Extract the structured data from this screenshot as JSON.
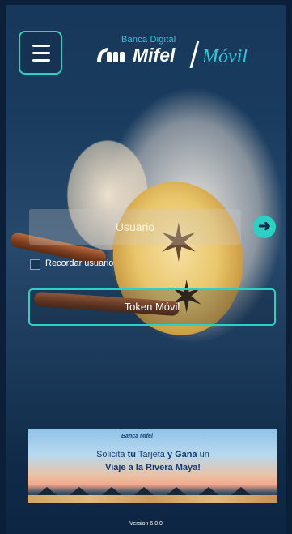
{
  "header": {
    "menu_icon": "hamburger-menu-icon",
    "logo_text": "Banca Digital Mifel Móvil"
  },
  "login": {
    "username_placeholder": "Usuario",
    "submit_icon": "arrow-right-icon",
    "remember_label": "Recordar usuario",
    "remember_checked": false,
    "token_button_label": "Token Móvil"
  },
  "banner": {
    "logo_text": "Banca Mifel",
    "line1_pre": "Solicita ",
    "line1_b1": "tu",
    "line1_mid": " Tarjeta ",
    "line1_b2": "y Gana",
    "line1_post": " un",
    "line2": "Viaje a la Rivera Maya!"
  },
  "footer": {
    "version": "Version 6.0.0"
  },
  "colors": {
    "accent": "#2bd1c4",
    "background": "#0d2a47",
    "banner_text": "#1d3f77"
  }
}
